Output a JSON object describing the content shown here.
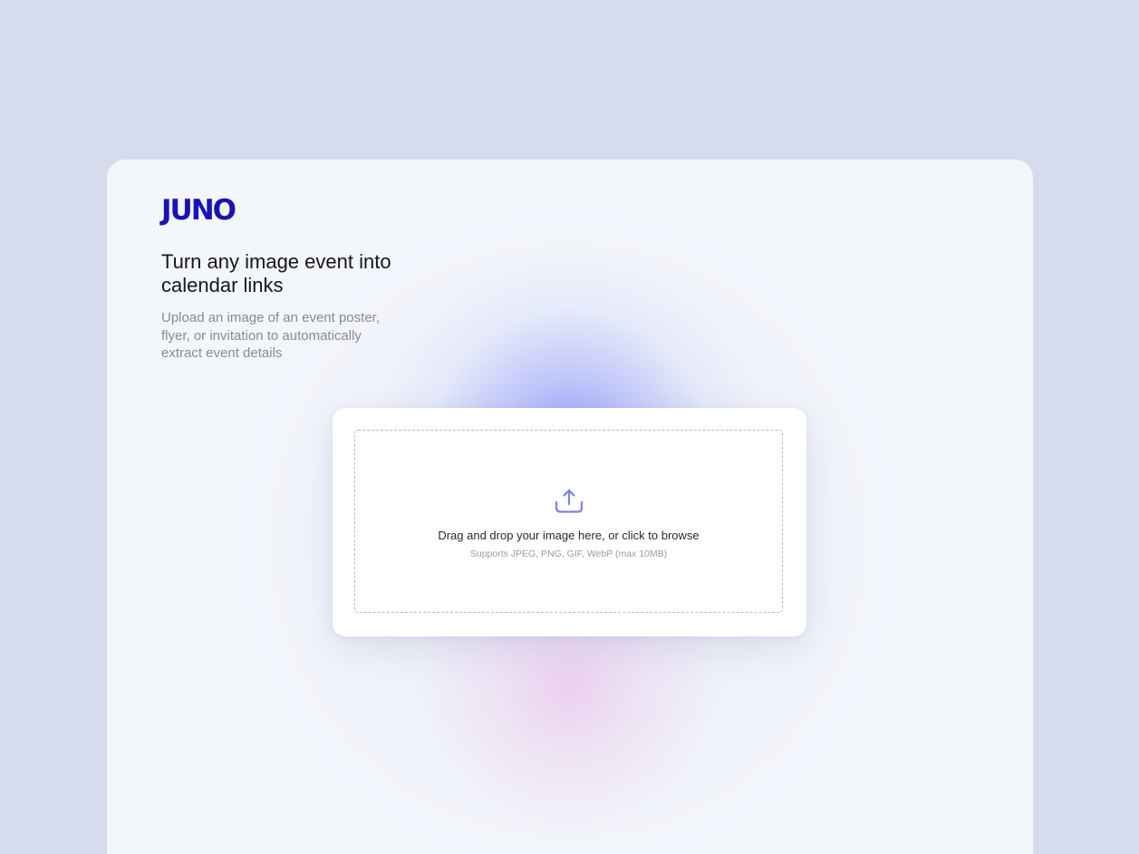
{
  "brand": {
    "logo_text": "JUNO",
    "logo_color": "#1a12b8"
  },
  "hero": {
    "headline": "Turn any image event into calendar links",
    "subtitle": "Upload an image of an event poster, flyer, or invitation to automatically extract event details"
  },
  "upload": {
    "icon": "upload-icon",
    "prompt": "Drag and drop your image here, or click to browse",
    "hint": "Supports JPEG, PNG, GIF, WebP (max 10MB)",
    "accent_color": "#7c83e8"
  },
  "colors": {
    "background": "#d6dbed",
    "card": "#f3f6fb",
    "glow_blue": "#a4abf7",
    "glow_pink": "#ecd2ee"
  }
}
